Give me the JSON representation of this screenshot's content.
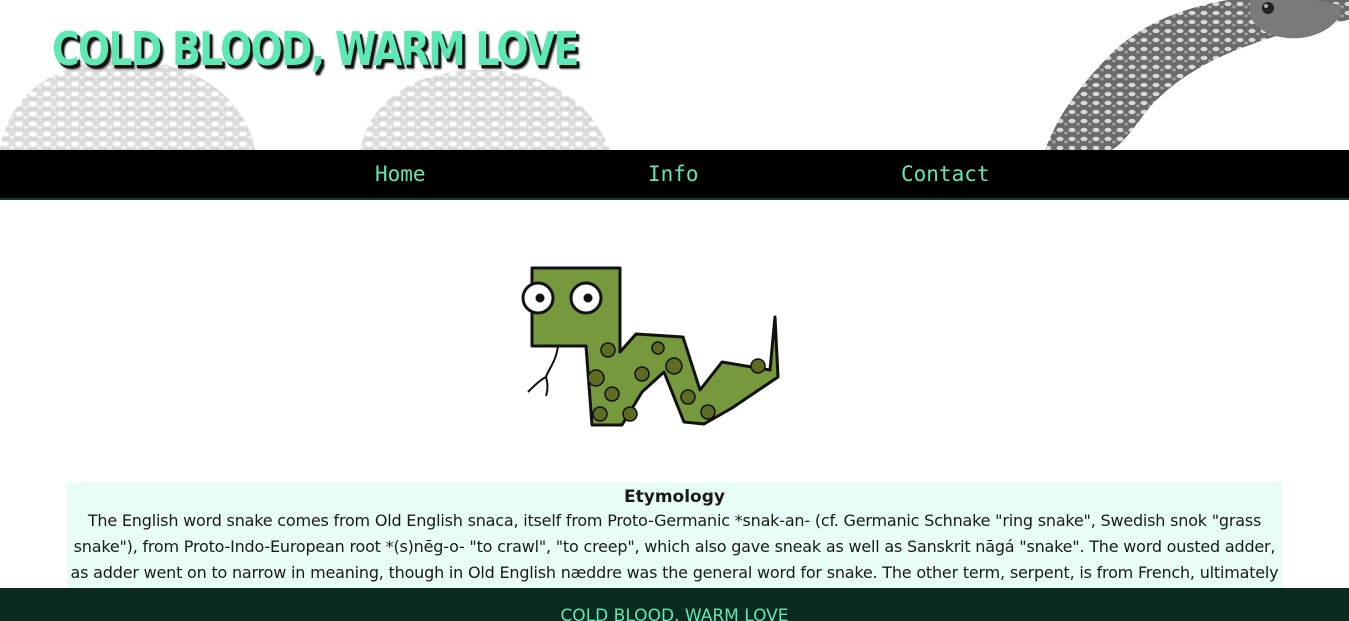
{
  "header": {
    "site_title": "COLD BLOOD, WARM LOVE"
  },
  "nav": {
    "items": [
      {
        "label": "Home"
      },
      {
        "label": "Info"
      },
      {
        "label": "Contact"
      }
    ]
  },
  "main": {
    "hero_image": "cartoon-snake-illustration",
    "etymology": {
      "title": "Etymology",
      "text": "The English word snake comes from Old English snaca, itself from Proto-Germanic *snak-an- (cf. Germanic Schnake \"ring snake\", Swedish snok \"grass snake\"), from Proto-Indo-European root *(s)nēg-o- \"to crawl\", \"to creep\", which also gave sneak as well as Sanskrit nāgá \"snake\". The word ousted adder, as adder went on to narrow in meaning, though in Old English næddre was the general word for snake. The other term, serpent, is from French, ultimately from Indo-European"
    }
  },
  "footer": {
    "text": "COLD BLOOD, WARM LOVE"
  },
  "colors": {
    "accent": "#5ee8b4",
    "nav_bg": "#000000",
    "footer_bg": "#0a2a20",
    "etym_bg": "#e8fdf5",
    "snake_green": "#76993e",
    "snake_spots": "#5e6b22"
  }
}
